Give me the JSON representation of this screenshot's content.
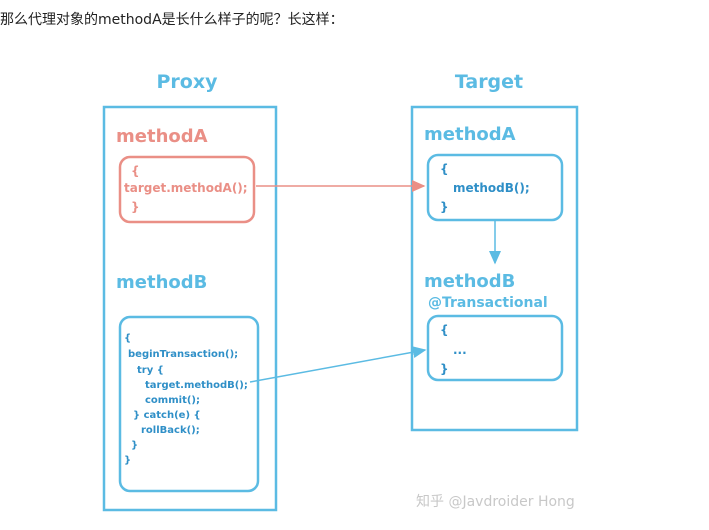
{
  "intro_text": "那么代理对象的methodA是长什么样子的呢？长这样：",
  "colors": {
    "blue": "#5bbbe3",
    "red": "#ea8f86",
    "text_blue": "#2f8fc7",
    "watermark": "#c8c8c8"
  },
  "proxy": {
    "title": "Proxy",
    "methodA": {
      "label": "methodA",
      "lines": [
        "{",
        "target.methodA();",
        "}"
      ]
    },
    "methodB": {
      "label": "methodB",
      "lines": [
        "{",
        "beginTransaction();",
        "try {",
        "target.methodB();",
        "commit();",
        "} catch(e) {",
        "rollBack();",
        "}",
        "}"
      ]
    }
  },
  "target": {
    "title": "Target",
    "methodA": {
      "label": "methodA",
      "lines": [
        "{",
        "methodB();",
        "}"
      ]
    },
    "methodB": {
      "label": "methodB",
      "annotation": "@Transactional",
      "lines": [
        "{",
        "...",
        "}"
      ]
    }
  },
  "watermark": "知乎 @Javdroider Hong"
}
